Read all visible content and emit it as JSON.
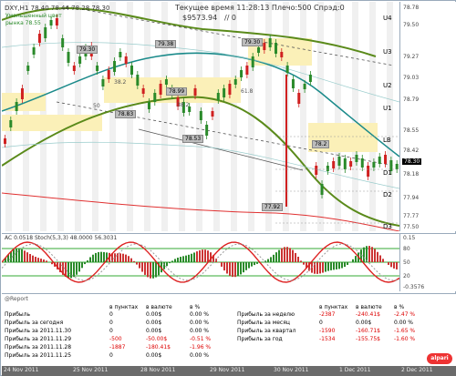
{
  "window": {
    "symbol_line": "DXY,H1  78.40 78.44 78.28 78.30",
    "server_time": "Текущее время 11:28:13 Плечо:500 Спрэд:0",
    "balance": "$9573.94",
    "balance_suffix": "// 0",
    "note_line1": "Уменьшенный цвет",
    "note_line2": "рынка 78.55"
  },
  "price_axis": {
    "ticks": [
      "78.78",
      "79.50",
      "79.27",
      "79.03",
      "78.79",
      "78.55",
      "78.42",
      "78.30",
      "78.18",
      "77.94",
      "77.77",
      "77.50"
    ],
    "current": "78.30"
  },
  "levels": {
    "u4": "U4",
    "u3": "U3",
    "u2": "U2",
    "u1": "U1",
    "lb": "LB",
    "d1": "D1",
    "d2": "D2",
    "d3": "D3"
  },
  "price_boxes": [
    "79.30",
    "79.38",
    "79.30",
    "78.99",
    "78.83",
    "78.53",
    "77.92",
    "78.2"
  ],
  "fib": {
    "f382": "38.2",
    "f50": "50",
    "f618": "61.8",
    "f382b": "38.2"
  },
  "oscillator": {
    "title": "AC 0.0518   Stoch(5,3,3) 48.0000 56.3031",
    "ticks": [
      "0.15",
      "80",
      "50",
      "20",
      "-0.3576"
    ]
  },
  "report": {
    "title": "@Report",
    "columns": [
      "в пунктах",
      "в валюте",
      "в %"
    ],
    "left_rows": [
      {
        "label": "Прибыль",
        "pts": "0",
        "cur": "0.00$",
        "pct": "0.00 %"
      },
      {
        "label": "Прибыль за сегодня",
        "pts": "0",
        "cur": "0.00$",
        "pct": "0.00 %"
      },
      {
        "label": "Прибыль за 2011.11.30",
        "pts": "0",
        "cur": "0.00$",
        "pct": "0.00 %"
      },
      {
        "label": "Прибыль за 2011.11.29",
        "pts": "-500",
        "cur": "-50.00$",
        "pct": "-0.51 %"
      },
      {
        "label": "Прибыль за 2011.11.28",
        "pts": "-1887",
        "cur": "-180.41$",
        "pct": "-1.96 %"
      },
      {
        "label": "Прибыль за 2011.11.25",
        "pts": "0",
        "cur": "0.00$",
        "pct": "0.00 %"
      }
    ],
    "right_rows": [
      {
        "label": "Прибыль за неделю",
        "pts": "-2387",
        "cur": "-240.41$",
        "pct": "-2.47 %"
      },
      {
        "label": "Прибыль за месяц",
        "pts": "0",
        "cur": "0.00$",
        "pct": "0.00 %"
      },
      {
        "label": "Прибыль за квартал",
        "pts": "-1590",
        "cur": "-160.71$",
        "pct": "-1.65 %"
      },
      {
        "label": "Прибыль за год",
        "pts": "-1534",
        "cur": "-155.75$",
        "pct": "-1.60 %"
      }
    ],
    "logo": "alpari"
  },
  "time_axis": [
    "24 Nov 2011",
    "25 Nov 2011",
    "28 Nov 2011",
    "29 Nov 2011",
    "30 Nov 2011",
    "1 Dec 2011",
    "2 Dec 2011"
  ],
  "colors": {
    "up": "#2a8a2a",
    "down": "#d02020",
    "ma_green": "#5a8a1a",
    "ma_teal": "#1a8a8a",
    "ma_red": "#e03030",
    "zone": "#fbf0b8"
  }
}
